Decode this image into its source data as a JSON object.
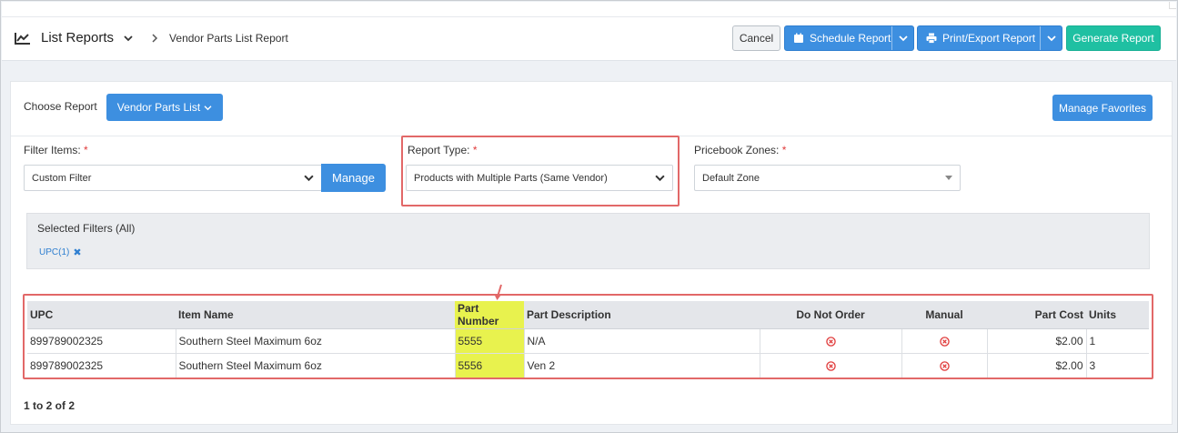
{
  "header": {
    "title": "List Reports",
    "breadcrumb": "Vendor Parts List Report",
    "cancel_label": "Cancel",
    "schedule_label": "Schedule Report",
    "print_label": "Print/Export Report",
    "generate_label": "Generate Report"
  },
  "controls": {
    "choose_label": "Choose Report",
    "report_button": "Vendor Parts List",
    "favorites_button": "Manage Favorites",
    "filter_items_label": "Filter Items:",
    "filter_items_value": "Custom Filter",
    "manage_button": "Manage",
    "report_type_label": "Report Type:",
    "report_type_value": "Products with Multiple Parts (Same Vendor)",
    "zones_label": "Pricebook Zones:",
    "zones_value": "Default Zone",
    "required_mark": "*"
  },
  "filters": {
    "title": "Selected Filters (All)",
    "chip": "UPC(1)",
    "chip_remove": "✖"
  },
  "table": {
    "columns": [
      "UPC",
      "Item Name",
      "Part Number",
      "Part Description",
      "Do Not Order",
      "Manual",
      "Part Cost",
      "Units"
    ],
    "rows": [
      {
        "upc": "899789002325",
        "item": "Southern Steel Maximum 6oz",
        "part": "5555",
        "desc": "N/A",
        "cost": "$2.00",
        "units": "1"
      },
      {
        "upc": "899789002325",
        "item": "Southern Steel Maximum 6oz",
        "part": "5556",
        "desc": "Ven 2",
        "cost": "$2.00",
        "units": "3"
      }
    ]
  },
  "pager": "1 to 2 of 2",
  "colors": {
    "primary": "#3d8fe0",
    "success": "#1fc0a2",
    "highlight": "#e8f24e",
    "annotation": "#e26868"
  }
}
